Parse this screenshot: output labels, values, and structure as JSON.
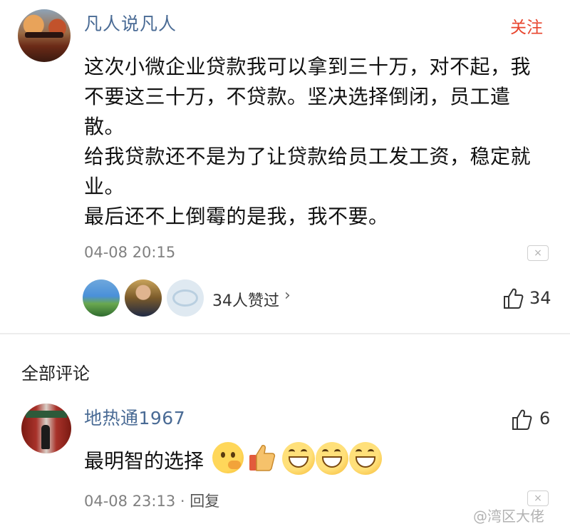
{
  "post": {
    "username": "凡人说凡人",
    "follow_label": "关注",
    "body": "这次小微企业贷款我可以拿到三十万，对不起，我\n不要这三十万，不贷款。坚决选择倒闭，员工遣\n散。\n给我贷款还不是为了让贷款给员工发工资，稳定就\n业。\n最后还不上倒霉的是我，我不要。",
    "timestamp": "04-08 20:15",
    "close_symbol": "×",
    "likers_text": "34人赞过",
    "likers_chevron": "›",
    "like_count": "34"
  },
  "comments_section": {
    "title": "全部评论"
  },
  "comment": {
    "username": "地热通1967",
    "like_count": "6",
    "body": "最明智的选择",
    "emojis": [
      "thinking-emoji",
      "thumbs-up-emoji",
      "grin-emoji",
      "grin-emoji",
      "grin-emoji"
    ],
    "timestamp": "04-08 23:13",
    "separator": " · ",
    "reply_label": "回复",
    "close_symbol": "×"
  },
  "watermark": "@湾区大佬",
  "colors": {
    "username": "#4a6b95",
    "follow": "#e8462f",
    "meta": "#808080"
  }
}
